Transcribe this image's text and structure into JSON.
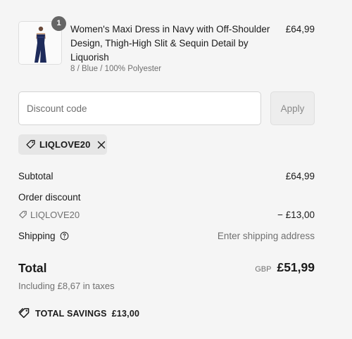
{
  "product": {
    "quantity": "1",
    "title": "Women's Maxi Dress in Navy with Off-Shoulder Design, Thigh-High Slit & Sequin Detail by Liquorish",
    "variant": "8 / Blue / 100% Polyester",
    "price": "£64,99",
    "image_alt": "Navy maxi dress product photo"
  },
  "discount": {
    "placeholder": "Discount code",
    "apply_label": "Apply",
    "applied_code": "LIQLOVE20"
  },
  "summary": {
    "subtotal_label": "Subtotal",
    "subtotal_value": "£64,99",
    "order_discount_label": "Order discount",
    "order_discount_code": "LIQLOVE20",
    "order_discount_value": "− £13,00",
    "shipping_label": "Shipping",
    "shipping_value": "Enter shipping address",
    "total_label": "Total",
    "currency": "GBP",
    "total_value": "£51,99",
    "taxes_note": "Including £8,67 in taxes",
    "savings_label": "TOTAL SAVINGS",
    "savings_value": "£13,00"
  },
  "icons": {
    "tag": "tag-icon",
    "remove": "close-icon",
    "info": "question-circle-icon",
    "savings": "savings-tag-icon"
  },
  "colors": {
    "background": "#f5f5f5",
    "text": "#1a1a1a",
    "muted": "#707070",
    "badge": "#666666"
  }
}
